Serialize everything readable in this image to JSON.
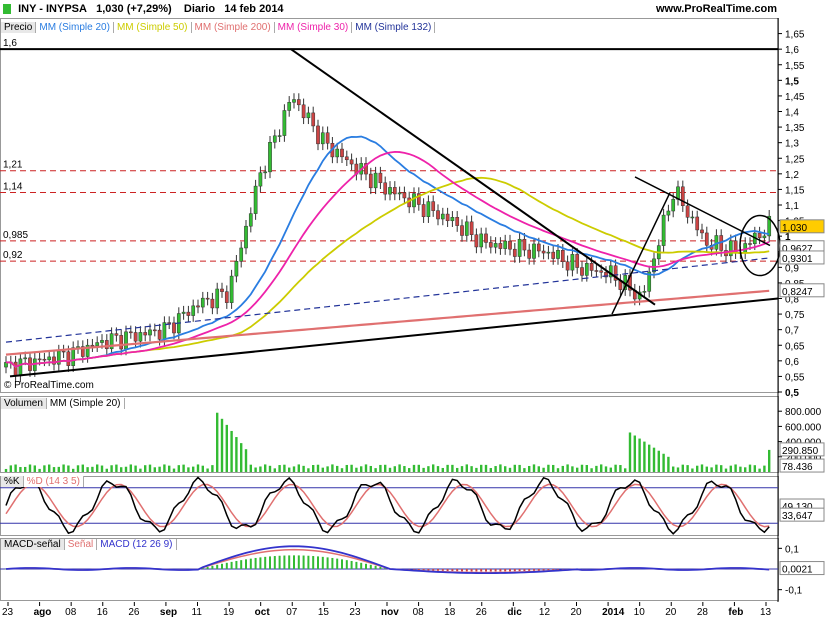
{
  "header": {
    "ticker": "INY - INYPSA",
    "last_change": "1,030 (+7,29%)",
    "period": "Diario",
    "date": "14 feb 2014",
    "site": "www.ProRealTime.com"
  },
  "watermark": "© ProRealTime.com",
  "colors": {
    "up": "#33bb33",
    "down": "#cc4444",
    "ma20": "#2a7de1",
    "ma50": "#cccc00",
    "ma200": "#e07070",
    "ma30": "#ee22aa",
    "ma132": "#223399",
    "volume": "#33bb33",
    "stoch_k": "#000000",
    "stoch_d": "#e07070",
    "macd": "#3333cc",
    "signal": "#e07070",
    "hist_up": "#33bb33",
    "hist_down": "#cc4444"
  },
  "chart_data": [
    {
      "type": "candlestick",
      "legend": [
        "Precio",
        "MM (Simple 20)",
        "MM (Simple 50)",
        "MM (Simple 200)",
        "MM (Simple 30)",
        "MM (Simple 132)"
      ],
      "ylim": [
        0.5,
        1.7
      ],
      "y_ticks": [
        "1,65",
        "1,6",
        "1,55",
        "1,5",
        "1,45",
        "1,4",
        "1,35",
        "1,3",
        "1,25",
        "1,2",
        "1,15",
        "1,1",
        "1,05",
        "1",
        "0,95",
        "0,9",
        "0,85",
        "0,8",
        "0,75",
        "0,7",
        "0,65",
        "0,6",
        "0,55",
        "0,5"
      ],
      "y_tick_values": [
        1.65,
        1.6,
        1.55,
        1.5,
        1.45,
        1.4,
        1.35,
        1.3,
        1.25,
        1.2,
        1.15,
        1.1,
        1.05,
        1.0,
        0.95,
        0.9,
        0.85,
        0.8,
        0.75,
        0.7,
        0.65,
        0.6,
        0.55,
        0.5
      ],
      "horizontal_lines": [
        {
          "label": "1,6",
          "value": 1.6,
          "style": "solid"
        },
        {
          "label": "1,21",
          "value": 1.21,
          "style": "dashed"
        },
        {
          "label": "1,14",
          "value": 1.14,
          "style": "dashed"
        },
        {
          "label": "0,985",
          "value": 0.985,
          "style": "dashed"
        },
        {
          "label": "0,92",
          "value": 0.92,
          "style": "dashed"
        }
      ],
      "value_badges": [
        {
          "label": "1,030",
          "value": 1.03,
          "color": "#ffcc00"
        },
        {
          "label": "0,9627",
          "value": 0.9627,
          "color": "#ffffff"
        },
        {
          "label": "0,9301",
          "value": 0.9301,
          "color": "#ffffff"
        },
        {
          "label": "0,8247",
          "value": 0.8247,
          "color": "#ffffff"
        }
      ],
      "x_ticks": [
        "23",
        "ago",
        "08",
        "16",
        "26",
        "sep",
        "11",
        "19",
        "oct",
        "07",
        "15",
        "23",
        "nov",
        "08",
        "18",
        "26",
        "dic",
        "12",
        "20",
        "2014",
        "10",
        "20",
        "28",
        "feb",
        "13"
      ],
      "closes_sample": [
        0.58,
        0.6,
        0.62,
        0.66,
        0.68,
        0.7,
        0.78,
        0.82,
        1.2,
        1.45,
        1.3,
        1.22,
        1.15,
        1.1,
        1.05,
        0.98,
        0.96,
        0.95,
        0.9,
        0.88,
        0.8,
        1.15,
        0.98,
        0.95,
        1.03
      ]
    },
    {
      "type": "bar",
      "legend": [
        "Volumen",
        "MM (Simple 20)"
      ],
      "y_ticks": [
        "800.000",
        "600.000",
        "400.000",
        "200.000"
      ],
      "y_tick_values": [
        800000,
        600000,
        400000,
        200000
      ],
      "value_badges": [
        {
          "label": "290.850",
          "value": 290850
        },
        {
          "label": "78.436",
          "value": 78436
        }
      ]
    },
    {
      "type": "line",
      "legend": [
        "%K",
        "%D (14 3 5)"
      ],
      "y_ticks": [
        "49,130",
        "33,647"
      ],
      "y_tick_values": [
        49.13,
        33.647
      ]
    },
    {
      "type": "line",
      "legend": [
        "MACD-señal",
        "Señal",
        "MACD (12 26 9)"
      ],
      "y_ticks": [
        "0,1",
        "-0,1"
      ],
      "y_tick_values": [
        0.1,
        -0.1
      ],
      "value_badges": [
        {
          "label": "0,0021",
          "value": 0.0021
        }
      ]
    }
  ]
}
